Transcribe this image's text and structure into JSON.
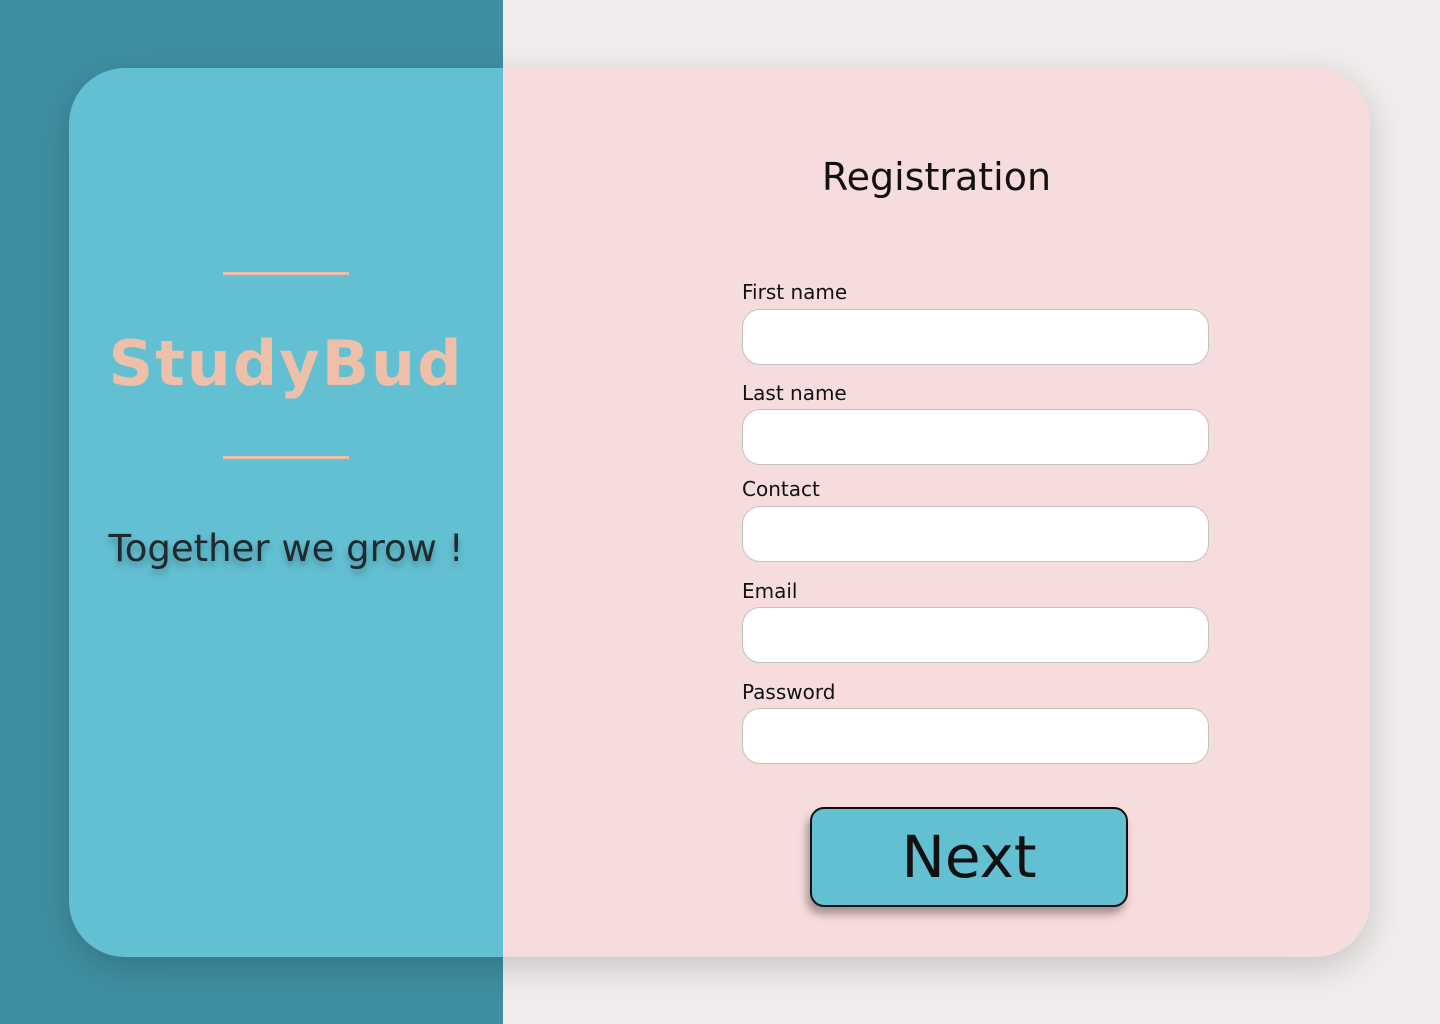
{
  "brand": {
    "name": "StudyBud",
    "tagline": "Together we grow !"
  },
  "form": {
    "title": "Registration",
    "fields": [
      {
        "label": "First name",
        "value": ""
      },
      {
        "label": "Last name",
        "value": ""
      },
      {
        "label": "Contact",
        "value": ""
      },
      {
        "label": "Email",
        "value": ""
      },
      {
        "label": "Password",
        "value": ""
      }
    ],
    "next_label": "Next"
  },
  "colors": {
    "teal_dark": "#3e8fa2",
    "teal": "#62c0d2",
    "pink": "#f7dcdd",
    "peach": "#eebfa9",
    "off_white": "#f2eded"
  }
}
